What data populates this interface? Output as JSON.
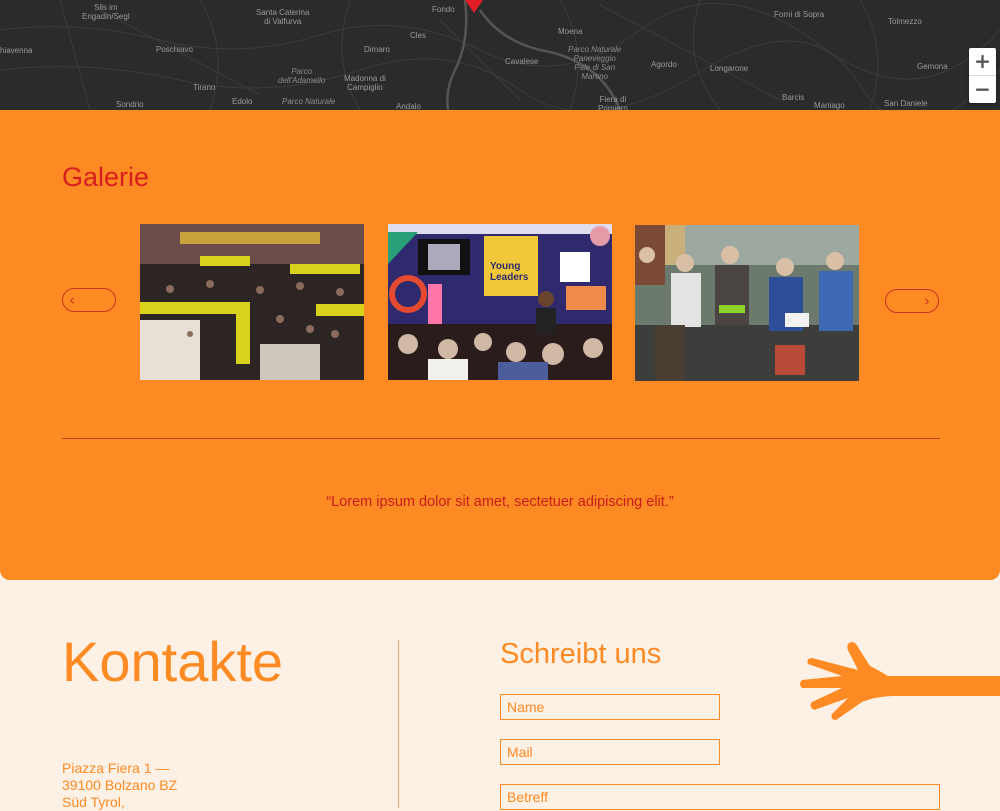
{
  "map": {
    "labels": [
      {
        "text": "Sils im\nEngadin/Segl",
        "style": "normal"
      },
      {
        "text": "Santa Caterina\ndi Valfurva",
        "style": "normal"
      },
      {
        "text": "Fondo",
        "style": "normal"
      },
      {
        "text": "Forni di Sopra",
        "style": "normal"
      },
      {
        "text": "Tolmezzo",
        "style": "normal"
      },
      {
        "text": "hiavenna",
        "style": "normal"
      },
      {
        "text": "Poschiavo",
        "style": "normal"
      },
      {
        "text": "Cles",
        "style": "normal"
      },
      {
        "text": "Moena",
        "style": "normal"
      },
      {
        "text": "Dimaro",
        "style": "normal"
      },
      {
        "text": "Parco Naturale\nPaneveggio\nPale di San\nMartino",
        "style": "italic"
      },
      {
        "text": "Parco\ndell'Adamello",
        "style": "italic"
      },
      {
        "text": "Cavalese",
        "style": "normal"
      },
      {
        "text": "Agordo",
        "style": "normal"
      },
      {
        "text": "Longarone",
        "style": "normal"
      },
      {
        "text": "Gemona",
        "style": "normal"
      },
      {
        "text": "Tirano",
        "style": "normal"
      },
      {
        "text": "Madonna di\nCampiglio",
        "style": "normal"
      },
      {
        "text": "Sondrio",
        "style": "normal"
      },
      {
        "text": "Edolo",
        "style": "normal"
      },
      {
        "text": "Parco Naturale",
        "style": "italic"
      },
      {
        "text": "Andalo",
        "style": "normal"
      },
      {
        "text": "Fiera di\nPrimiero",
        "style": "normal"
      },
      {
        "text": "Barcis",
        "style": "normal"
      },
      {
        "text": "Maniago",
        "style": "normal"
      },
      {
        "text": "San Daniele",
        "style": "normal"
      }
    ],
    "zoom_in": "+",
    "zoom_out": "−"
  },
  "gallery": {
    "title": "Galerie",
    "prev_icon": "‹",
    "next_icon": "›",
    "photos": [
      {
        "alt": "crowded exhibition hall"
      },
      {
        "alt": "Young Leaders panel"
      },
      {
        "alt": "students seated in a room"
      }
    ],
    "quote": "“Lorem ipsum dolor sit amet, sectetuer adipiscing elit.”",
    "accent": "#fe8a23"
  },
  "contact": {
    "title": "Kontakte",
    "address_lines": [
      "Piazza Fiera 1 —",
      "39100 Bolzano BZ",
      "Süd Tyrol,"
    ],
    "form_title": "Schreibt uns",
    "name_placeholder": "Name",
    "mail_placeholder": "Mail",
    "subject_placeholder": "Betreff"
  },
  "colors": {
    "orange": "#fe8a23",
    "red": "#d81e1e",
    "cream": "#fdf1e6",
    "map": "#2b2b2d"
  }
}
